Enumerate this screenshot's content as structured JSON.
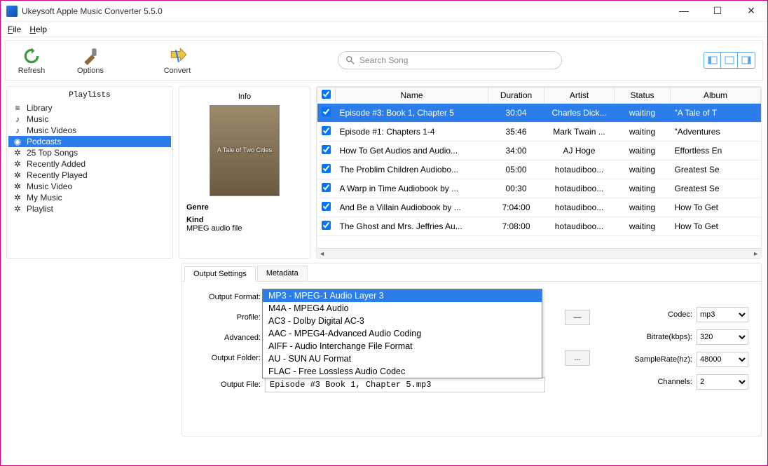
{
  "window": {
    "title": "Ukeysoft Apple Music Converter 5.5.0"
  },
  "menubar": {
    "file": "File",
    "help": "Help"
  },
  "toolbar": {
    "refresh": "Refresh",
    "options": "Options",
    "convert": "Convert",
    "search_placeholder": "Search Song"
  },
  "playlists": {
    "title": "Playlists",
    "items": [
      {
        "label": "Library",
        "icon": "stack"
      },
      {
        "label": "Music",
        "icon": "note"
      },
      {
        "label": "Music Videos",
        "icon": "note"
      },
      {
        "label": "Podcasts",
        "icon": "podcast",
        "selected": true
      },
      {
        "label": "25 Top Songs",
        "icon": "gear"
      },
      {
        "label": "Recently Added",
        "icon": "gear"
      },
      {
        "label": "Recently Played",
        "icon": "gear"
      },
      {
        "label": "Music Video",
        "icon": "gear"
      },
      {
        "label": "My Music",
        "icon": "gear"
      },
      {
        "label": "Playlist",
        "icon": "gear"
      }
    ]
  },
  "info": {
    "title": "Info",
    "thumb_text": "A Tale of Two Cities",
    "genre_label": "Genre",
    "genre_value": "",
    "kind_label": "Kind",
    "kind_value": "MPEG audio file"
  },
  "table": {
    "headers": {
      "name": "Name",
      "duration": "Duration",
      "artist": "Artist",
      "status": "Status",
      "album": "Album"
    },
    "rows": [
      {
        "checked": true,
        "name": "Episode #3: Book 1, Chapter 5",
        "duration": "30:04",
        "artist": "Charles Dick...",
        "status": "waiting",
        "album": "\"A Tale of T",
        "selected": true
      },
      {
        "checked": true,
        "name": "Episode #1: Chapters 1-4",
        "duration": "35:46",
        "artist": "Mark Twain ...",
        "status": "waiting",
        "album": "\"Adventures"
      },
      {
        "checked": true,
        "name": "How To Get Audios and Audio...",
        "duration": "34:00",
        "artist": "AJ Hoge",
        "status": "waiting",
        "album": "Effortless En"
      },
      {
        "checked": true,
        "name": "The Problim Children Audiobo...",
        "duration": "05:00",
        "artist": "hotaudiboo...",
        "status": "waiting",
        "album": "Greatest Se"
      },
      {
        "checked": true,
        "name": "A Warp in Time Audiobook by ...",
        "duration": "00:30",
        "artist": "hotaudiboo...",
        "status": "waiting",
        "album": "Greatest Se"
      },
      {
        "checked": true,
        "name": "And Be a Villain Audiobook by ...",
        "duration": "7:04:00",
        "artist": "hotaudiboo...",
        "status": "waiting",
        "album": "How To Get"
      },
      {
        "checked": true,
        "name": "The Ghost and Mrs. Jeffries Au...",
        "duration": "7:08:00",
        "artist": "hotaudiboo...",
        "status": "waiting",
        "album": "How To Get"
      }
    ]
  },
  "tabs": {
    "output_settings": "Output Settings",
    "metadata": "Metadata"
  },
  "form": {
    "output_format_label": "Output Format:",
    "profile_label": "Profile:",
    "advanced_label": "Advanced:",
    "output_folder_label": "Output Folder:",
    "output_file_label": "Output File:",
    "output_file_value": "Episode #3 Book 1, Chapter 5.mp3",
    "browse": "...",
    "dash": "—"
  },
  "dropdown": {
    "options": [
      "MP3 - MPEG-1 Audio Layer 3",
      "M4A - MPEG4 Audio",
      "AC3 - Dolby Digital AC-3",
      "AAC - MPEG4-Advanced Audio Coding",
      "AIFF - Audio Interchange File Format",
      "AU - SUN AU Format",
      "FLAC - Free Lossless Audio Codec"
    ]
  },
  "config": {
    "codec_label": "Codec:",
    "codec_value": "mp3",
    "bitrate_label": "Bitrate(kbps):",
    "bitrate_value": "320",
    "samplerate_label": "SampleRate(hz):",
    "samplerate_value": "48000",
    "channels_label": "Channels:",
    "channels_value": "2"
  }
}
